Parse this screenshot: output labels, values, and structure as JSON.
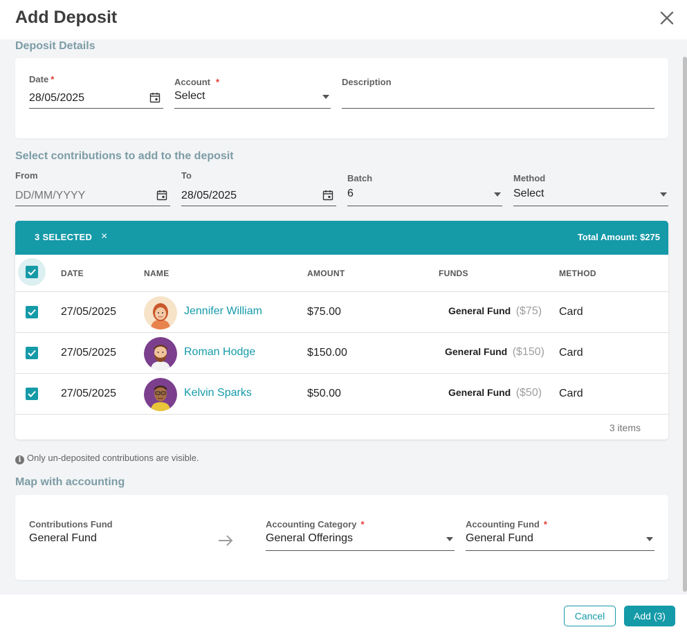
{
  "dialog": {
    "title": "Add Deposit"
  },
  "deposit_details": {
    "section_title": "Deposit Details",
    "date": {
      "label": "Date",
      "value": "28/05/2025"
    },
    "account": {
      "label": "Account",
      "value": "Select"
    },
    "description": {
      "label": "Description",
      "value": ""
    }
  },
  "contributions": {
    "section_title": "Select contributions to add to the deposit",
    "from": {
      "label": "From",
      "placeholder": "DD/MM/YYYY"
    },
    "to": {
      "label": "To",
      "value": "28/05/2025"
    },
    "batch": {
      "label": "Batch",
      "value": "6"
    },
    "method": {
      "label": "Method",
      "value": "Select"
    }
  },
  "grid": {
    "selected_label": "3 SELECTED",
    "clear_glyph": "×",
    "total_label": "Total Amount: $275",
    "columns": {
      "date": "DATE",
      "name": "NAME",
      "amount": "AMOUNT",
      "funds": "FUNDS",
      "method": "METHOD"
    },
    "rows": [
      {
        "date": "27/05/2025",
        "name": "Jennifer William",
        "amount": "$75.00",
        "fund": "General Fund",
        "fund_amount": "($75)",
        "method": "Card"
      },
      {
        "date": "27/05/2025",
        "name": "Roman Hodge",
        "amount": "$150.00",
        "fund": "General Fund",
        "fund_amount": "($150)",
        "method": "Card"
      },
      {
        "date": "27/05/2025",
        "name": "Kelvin Sparks",
        "amount": "$50.00",
        "fund": "General Fund",
        "fund_amount": "($50)",
        "method": "Card"
      }
    ],
    "items_count": "3 items"
  },
  "info_note": "Only un-deposited contributions are visible.",
  "mapping": {
    "section_title": "Map with accounting",
    "contributions_fund": {
      "label": "Contributions Fund",
      "value": "General Fund"
    },
    "accounting_category": {
      "label": "Accounting Category",
      "value": "General Offerings"
    },
    "accounting_fund": {
      "label": "Accounting Fund",
      "value": "General Fund"
    }
  },
  "footer": {
    "cancel_label": "Cancel",
    "add_label": "Add (3)"
  },
  "colors": {
    "accent": "#159aa8",
    "section_title": "#7c9ca5",
    "required": "#e53935"
  }
}
